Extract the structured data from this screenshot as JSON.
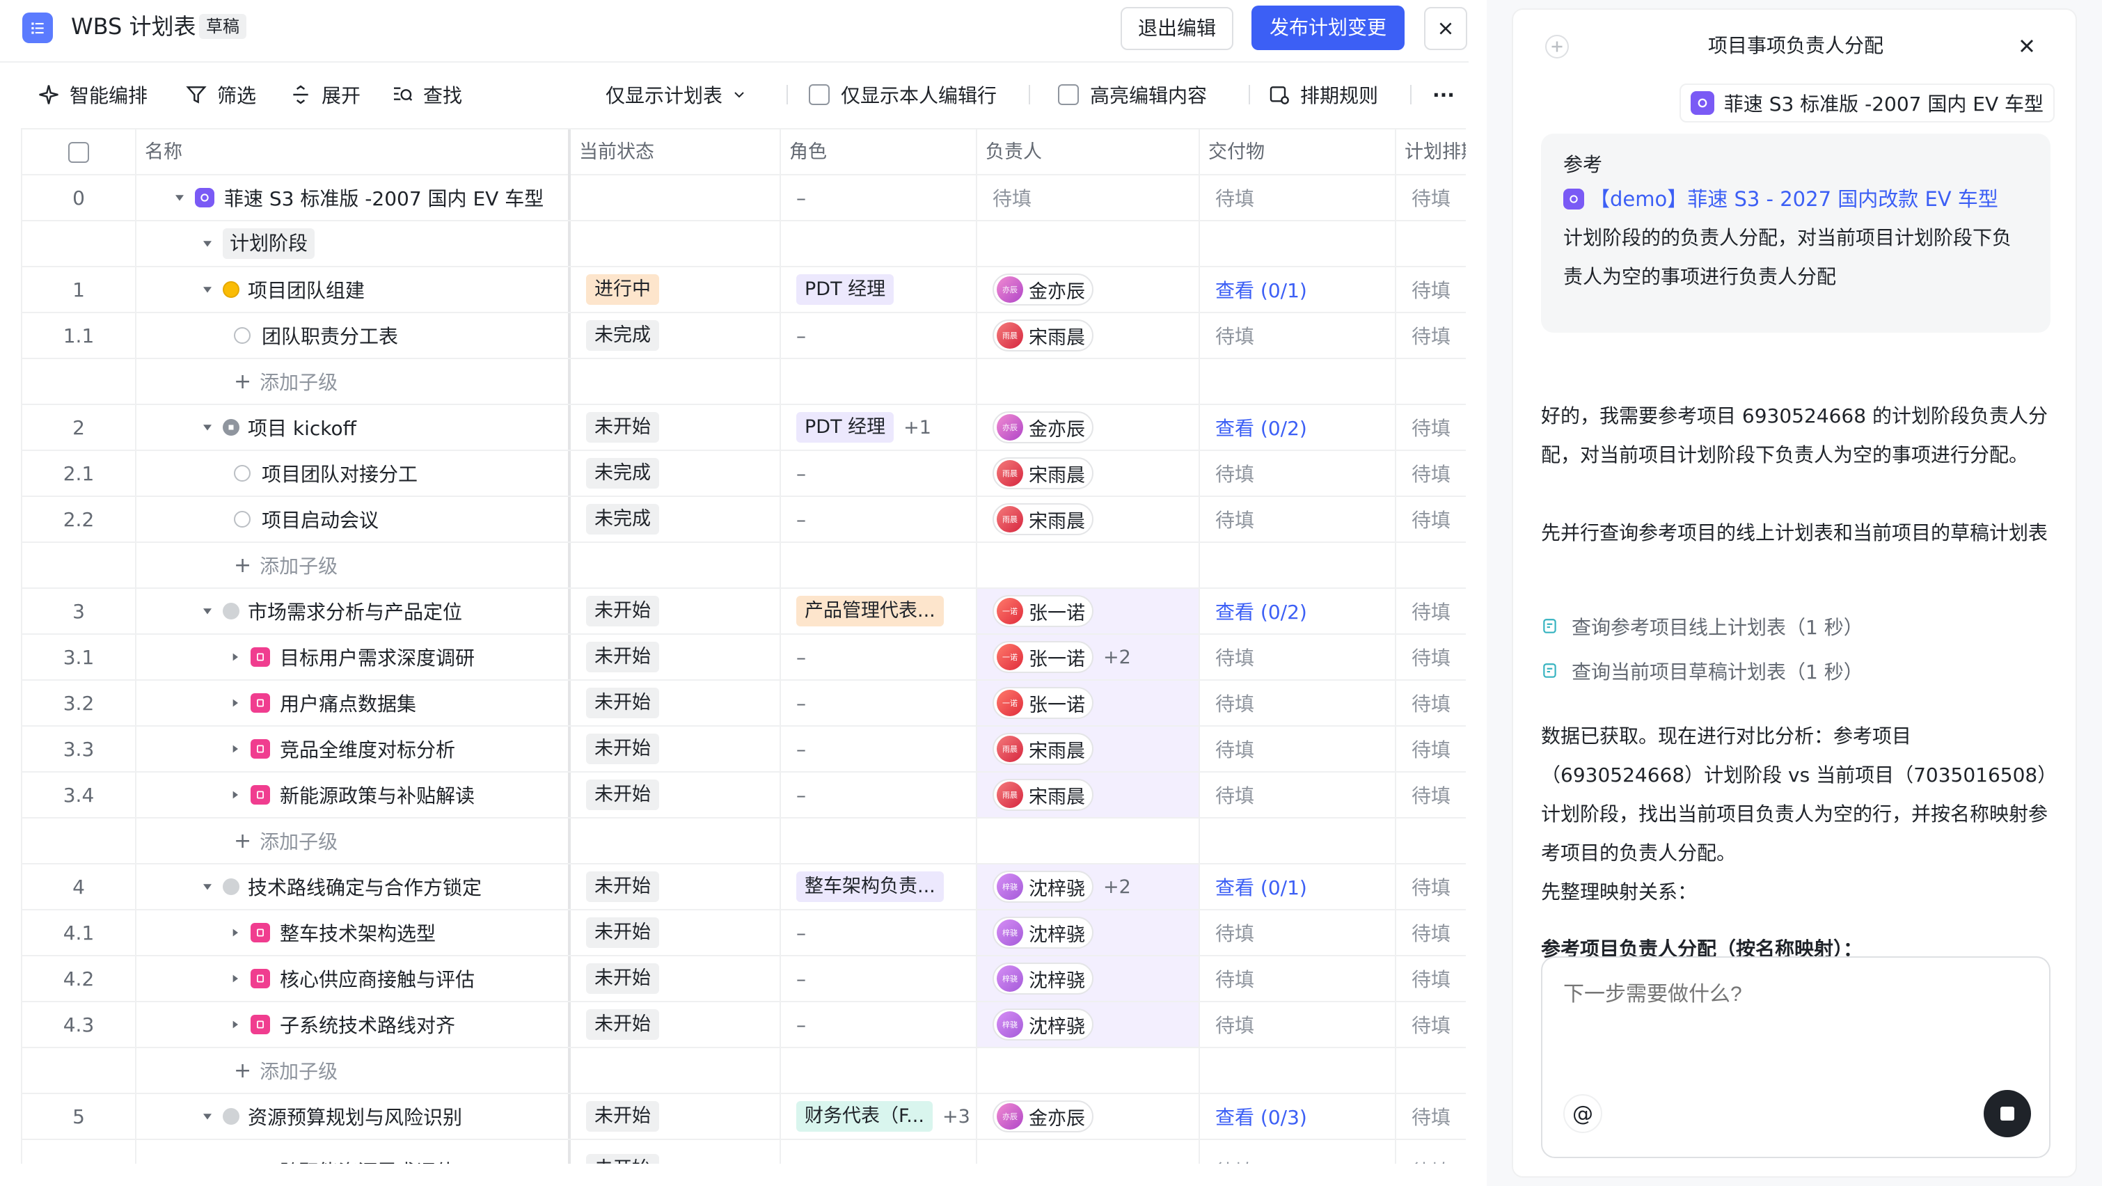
{
  "header": {
    "title": "WBS 计划表",
    "draft_badge": "草稿",
    "exit_label": "退出编辑",
    "publish_label": "发布计划变更"
  },
  "toolbar": {
    "smart": "智能编排",
    "filter": "筛选",
    "expand": "展开",
    "find": "查找",
    "view_select": "仅显示计划表",
    "only_mine": "仅显示本人编辑行",
    "highlight": "高亮编辑内容",
    "rules": "排期规则",
    "more": "···"
  },
  "columns": [
    "名称",
    "当前状态",
    "角色",
    "负责人",
    "交付物",
    "计划排期"
  ],
  "rows": {
    "r0": {
      "num": "0",
      "name": "菲速 S3 标准版 -2007 国内 EV 车型",
      "role": "–",
      "owner": "待填",
      "deliv": "待填",
      "sched": "待填"
    },
    "phase": {
      "name": "计划阶段"
    },
    "r1": {
      "num": "1",
      "name": "项目团队组建",
      "status": "进行中",
      "role": "PDT 经理",
      "owner": "金亦辰",
      "owner_short": "亦辰",
      "deliv": "查看 (0/1)",
      "sched": "待填"
    },
    "r1_1": {
      "num": "1.1",
      "name": "团队职责分工表",
      "status": "未完成",
      "role": "–",
      "owner": "宋雨晨",
      "owner_short": "雨晨",
      "deliv": "待填",
      "sched": "待填"
    },
    "add1": {
      "label": "添加子级"
    },
    "r2": {
      "num": "2",
      "name": "项目 kickoff",
      "status": "未开始",
      "role": "PDT 经理",
      "role_extra": "+1",
      "owner": "金亦辰",
      "owner_short": "亦辰",
      "deliv": "查看 (0/2)",
      "sched": "待填"
    },
    "r2_1": {
      "num": "2.1",
      "name": "项目团队对接分工",
      "status": "未完成",
      "role": "–",
      "owner": "宋雨晨",
      "owner_short": "雨晨",
      "deliv": "待填",
      "sched": "待填"
    },
    "r2_2": {
      "num": "2.2",
      "name": "项目启动会议",
      "status": "未完成",
      "role": "–",
      "owner": "宋雨晨",
      "owner_short": "雨晨",
      "deliv": "待填",
      "sched": "待填"
    },
    "add2": {
      "label": "添加子级"
    },
    "r3": {
      "num": "3",
      "name": "市场需求分析与产品定位",
      "status": "未开始",
      "role": "产品管理代表...",
      "owner": "张一诺",
      "owner_short": "一诺",
      "deliv": "查看 (0/2)",
      "sched": "待填"
    },
    "r3_1": {
      "num": "3.1",
      "name": "目标用户需求深度调研",
      "status": "未开始",
      "role": "–",
      "owner": "张一诺",
      "owner_short": "一诺",
      "owner_extra": "+2",
      "deliv": "待填",
      "sched": "待填"
    },
    "r3_2": {
      "num": "3.2",
      "name": "用户痛点数据集",
      "status": "未开始",
      "role": "–",
      "owner": "张一诺",
      "owner_short": "一诺",
      "deliv": "待填",
      "sched": "待填"
    },
    "r3_3": {
      "num": "3.3",
      "name": "竞品全维度对标分析",
      "status": "未开始",
      "role": "–",
      "owner": "宋雨晨",
      "owner_short": "雨晨",
      "deliv": "待填",
      "sched": "待填"
    },
    "r3_4": {
      "num": "3.4",
      "name": "新能源政策与补贴解读",
      "status": "未开始",
      "role": "–",
      "owner": "宋雨晨",
      "owner_short": "雨晨",
      "deliv": "待填",
      "sched": "待填"
    },
    "add3": {
      "label": "添加子级"
    },
    "r4": {
      "num": "4",
      "name": "技术路线确定与合作方锁定",
      "status": "未开始",
      "role": "整车架构负责...",
      "owner": "沈梓骁",
      "owner_short": "梓骁",
      "owner_extra": "+2",
      "deliv": "查看 (0/1)",
      "sched": "待填"
    },
    "r4_1": {
      "num": "4.1",
      "name": "整车技术架构选型",
      "status": "未开始",
      "role": "–",
      "owner": "沈梓骁",
      "owner_short": "梓骁",
      "deliv": "待填",
      "sched": "待填"
    },
    "r4_2": {
      "num": "4.2",
      "name": "核心供应商接触与评估",
      "status": "未开始",
      "role": "–",
      "owner": "沈梓骁",
      "owner_short": "梓骁",
      "deliv": "待填",
      "sched": "待填"
    },
    "r4_3": {
      "num": "4.3",
      "name": "子系统技术路线对齐",
      "status": "未开始",
      "role": "–",
      "owner": "沈梓骁",
      "owner_short": "梓骁",
      "deliv": "待填",
      "sched": "待填"
    },
    "add4": {
      "label": "添加子级"
    },
    "r5": {
      "num": "5",
      "name": "资源预算规划与风险识别",
      "status": "未开始",
      "role": "财务代表（F...",
      "role_extra": "+3",
      "owner": "金亦辰",
      "owner_short": "亦辰",
      "deliv": "查看 (0/3)",
      "sched": "待填"
    },
    "r5_1": {
      "num": "5.1",
      "name": "跨职能资源需求评估",
      "status": "未开始",
      "deliv": "待填",
      "sched": "待填"
    }
  },
  "panel": {
    "title": "项目事项负责人分配",
    "project_chip": "菲速 S3 标准版 -2007 国内 EV 车型",
    "ref_label": "参考",
    "ref_link": "【demo】菲速 S3 - 2027 国内改款 EV 车型",
    "ref_text": "计划阶段的的负责人分配，对当前项目计划阶段下负责人为空的事项进行负责人分配",
    "msg1": "好的，我需要参考项目 6930524668 的计划阶段负责人分配，对当前项目计划阶段下负责人为空的事项进行分配。",
    "msg2": "先并行查询参考项目的线上计划表和当前项目的草稿计划表",
    "tool1": "查询参考项目线上计划表（1 秒）",
    "tool2": "查询当前项目草稿计划表（1 秒）",
    "msg3": "数据已获取。现在进行对比分析：参考项目（6930524668）计划阶段 vs 当前项目（7035016508）计划阶段，找出当前项目负责人为空的行，并按名称映射参考项目的负责人分配。",
    "msg4": "先整理映射关系：",
    "msg_bold": "参考项目负责人分配（按名称映射）：",
    "input_placeholder": "下一步需要做什么?"
  }
}
